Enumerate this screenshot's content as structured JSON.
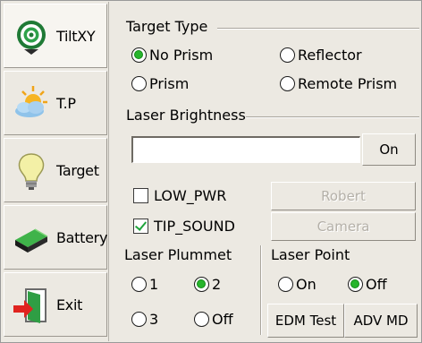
{
  "sidebar": {
    "items": [
      {
        "label": "TiltXY",
        "icon": "tilt-target-icon",
        "active": true
      },
      {
        "label": "T.P",
        "icon": "sun-cloud-icon",
        "active": false
      },
      {
        "label": "Target",
        "icon": "lightbulb-icon",
        "active": false
      },
      {
        "label": "Battery",
        "icon": "battery-icon",
        "active": false
      },
      {
        "label": "Exit",
        "icon": "exit-door-icon",
        "active": false
      }
    ]
  },
  "target_type": {
    "title": "Target Type",
    "options": [
      {
        "label": "No Prism",
        "selected": true
      },
      {
        "label": "Reflector",
        "selected": false
      },
      {
        "label": "Prism",
        "selected": false
      },
      {
        "label": "Remote Prism",
        "selected": false
      }
    ]
  },
  "laser_brightness": {
    "title": "Laser Brightness",
    "level": 0,
    "on_label": "On"
  },
  "checkboxes": [
    {
      "label": "LOW_PWR",
      "checked": false
    },
    {
      "label": "TIP_SOUND",
      "checked": true
    }
  ],
  "disabled_buttons": [
    "Robert",
    "Camera"
  ],
  "laser_plummet": {
    "title": "Laser Plummet",
    "options": [
      {
        "label": "1",
        "selected": false
      },
      {
        "label": "2",
        "selected": true
      },
      {
        "label": "3",
        "selected": false
      },
      {
        "label": "Off",
        "selected": false
      }
    ]
  },
  "laser_point": {
    "title": "Laser Point",
    "options": [
      {
        "label": "On",
        "selected": false
      },
      {
        "label": "Off",
        "selected": true
      }
    ]
  },
  "bottom_buttons": [
    "EDM Test",
    "ADV MD"
  ],
  "colors": {
    "selected_radio": "#27b52c",
    "panel": "#ece9e2"
  }
}
